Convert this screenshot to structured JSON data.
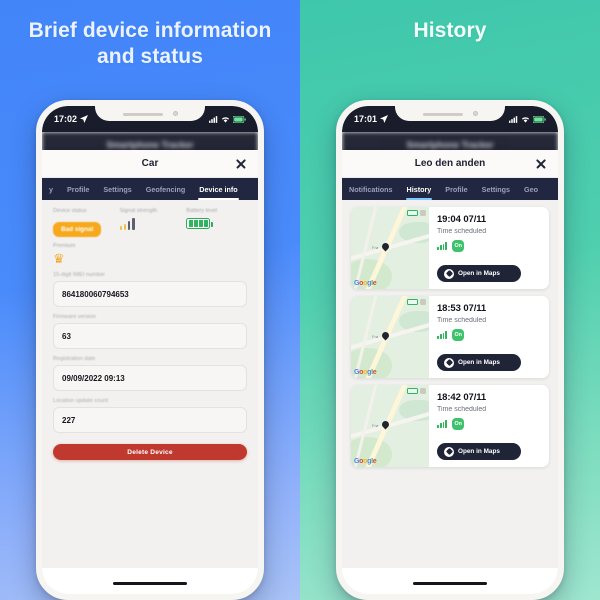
{
  "left": {
    "heading": "Brief device information and status",
    "background_color": "#4a8bfb",
    "status_bar": {
      "time": "17:02",
      "location_icon": "location-arrow-icon",
      "signal_icon": "cellular-icon",
      "wifi_icon": "wifi-icon",
      "battery_icon": "battery-icon"
    },
    "app_header_title": "Smartphone Tracker",
    "sheet": {
      "title": "Car",
      "close_icon": "close-icon"
    },
    "tabs": [
      {
        "label": "y",
        "active": false
      },
      {
        "label": "Profile",
        "active": false
      },
      {
        "label": "Settings",
        "active": false
      },
      {
        "label": "Geofencing",
        "active": false
      },
      {
        "label": "Device info",
        "active": true
      }
    ],
    "stats": [
      {
        "label": "Device status",
        "type": "badge",
        "value": "Bad signal",
        "color": "#f7a81b"
      },
      {
        "label": "Signal strength",
        "type": "bars",
        "value": "3",
        "color": "#5c6070"
      },
      {
        "label": "Battery level",
        "type": "battery",
        "value": "100",
        "color": "#31b45f"
      }
    ],
    "premium": {
      "label": "Premium",
      "icon": "crown-icon"
    },
    "fields": [
      {
        "label": "15-digit IMEI number",
        "value": "864180060794653"
      },
      {
        "label": "Firmware version",
        "value": "63"
      },
      {
        "label": "Registration date",
        "value": "09/09/2022 09:13"
      },
      {
        "label": "Location update count",
        "value": "227"
      }
    ],
    "delete_button": "Delete Device"
  },
  "right": {
    "heading": "History",
    "background_color": "#4fcfae",
    "status_bar": {
      "time": "17:01",
      "location_icon": "location-arrow-icon",
      "signal_icon": "cellular-icon",
      "wifi_icon": "wifi-icon",
      "battery_icon": "battery-icon"
    },
    "app_header_title": "Smartphone Tracker",
    "sheet": {
      "title": "Leo den anden",
      "close_icon": "close-icon"
    },
    "tabs": [
      {
        "label": "Notifications",
        "active": false
      },
      {
        "label": "History",
        "active": true
      },
      {
        "label": "Profile",
        "active": false
      },
      {
        "label": "Settings",
        "active": false
      },
      {
        "label": "Geo",
        "active": false
      }
    ],
    "history": [
      {
        "time": "19:04 07/11",
        "subtitle": "Time scheduled",
        "status": "On",
        "map_label": "Frø",
        "maps_button": "Open in Maps",
        "attribution": "Google"
      },
      {
        "time": "18:53 07/11",
        "subtitle": "Time scheduled",
        "status": "On",
        "map_label": "Frø",
        "maps_button": "Open in Maps",
        "attribution": "Google"
      },
      {
        "time": "18:42 07/11",
        "subtitle": "Time scheduled",
        "status": "On",
        "map_label": "Frø",
        "maps_button": "Open in Maps",
        "attribution": "Google"
      }
    ]
  }
}
